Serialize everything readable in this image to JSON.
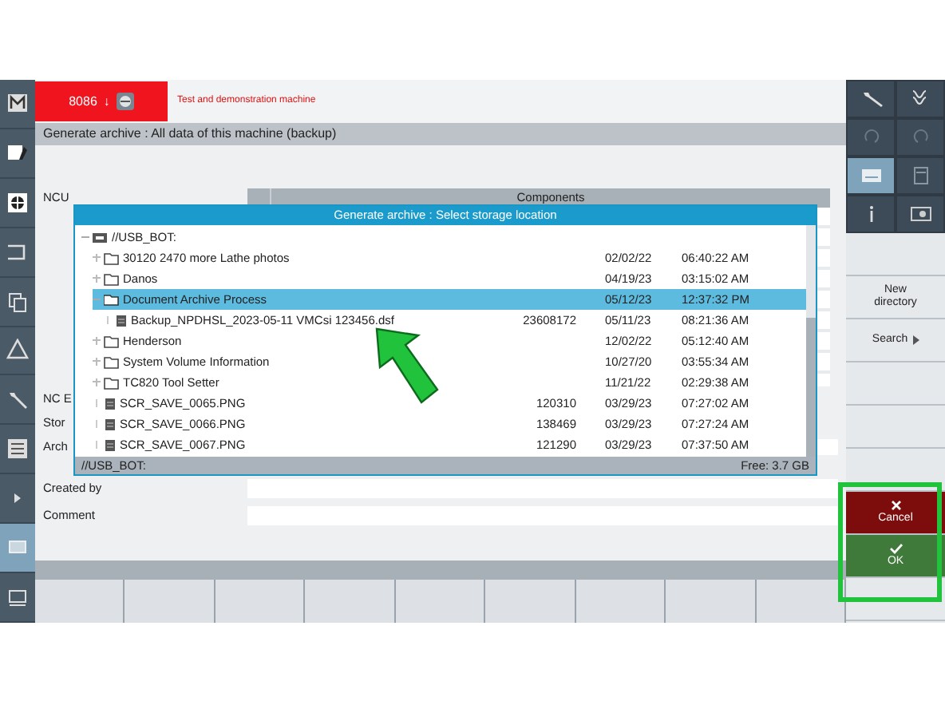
{
  "header": {
    "channel": "8086",
    "channel_mark": "↓",
    "machine": "Test and demonstration machine"
  },
  "title": "Generate archive : All data of this machine (backup)",
  "background": {
    "ncu_label": "NCU",
    "components_header": "Components",
    "rows": [
      {
        "label": "NC E",
        "field": false
      },
      {
        "label": "Stor",
        "field": false
      },
      {
        "label": "Arch",
        "field": true
      }
    ]
  },
  "dialog": {
    "title": "Generate archive : Select storage location",
    "tree": [
      {
        "kind": "drive",
        "name": "//USB_BOT:",
        "expanded": true,
        "selected": false,
        "children": [
          {
            "kind": "folder",
            "name": "30120 2470 more Lathe photos",
            "date": "02/02/22",
            "time": "06:40:22 AM",
            "expanded": false,
            "selected": false
          },
          {
            "kind": "folder",
            "name": "Danos",
            "date": "04/19/23",
            "time": "03:15:02 AM",
            "expanded": false,
            "selected": false
          },
          {
            "kind": "folder",
            "name": "Document Archive Process",
            "date": "05/12/23",
            "time": "12:37:32 PM",
            "expanded": true,
            "selected": true,
            "children": [
              {
                "kind": "file",
                "name": "Backup_NPDHSL_2023-05-11 VMCsi 123456.dsf",
                "size": "23608172",
                "date": "05/11/23",
                "time": "08:21:36 AM",
                "selected": false
              }
            ]
          },
          {
            "kind": "folder",
            "name": "Henderson",
            "date": "12/02/22",
            "time": "05:12:40 AM",
            "expanded": false,
            "selected": false
          },
          {
            "kind": "folder",
            "name": "System Volume Information",
            "date": "10/27/20",
            "time": "03:55:34 AM",
            "expanded": false,
            "selected": false
          },
          {
            "kind": "folder",
            "name": "TC820 Tool Setter",
            "date": "11/21/22",
            "time": "02:29:38 AM",
            "expanded": false,
            "selected": false
          },
          {
            "kind": "file",
            "name": "SCR_SAVE_0065.PNG",
            "size": "120310",
            "date": "03/29/23",
            "time": "07:27:02 AM",
            "selected": false
          },
          {
            "kind": "file",
            "name": "SCR_SAVE_0066.PNG",
            "size": "138469",
            "date": "03/29/23",
            "time": "07:27:24 AM",
            "selected": false
          },
          {
            "kind": "file",
            "name": "SCR_SAVE_0067.PNG",
            "size": "121290",
            "date": "03/29/23",
            "time": "07:37:50 AM",
            "selected": false
          }
        ]
      }
    ],
    "path": "//USB_BOT:",
    "free": "Free: 3.7 GB"
  },
  "form": [
    {
      "label": "Created by"
    },
    {
      "label": "Comment"
    }
  ],
  "softkeys": [
    {
      "kind": "blank"
    },
    {
      "kind": "key",
      "label": "New directory",
      "submenu": false
    },
    {
      "kind": "key",
      "label": "Search",
      "submenu": true
    },
    {
      "kind": "blank"
    },
    {
      "kind": "blank"
    },
    {
      "kind": "blank"
    },
    {
      "kind": "cancel",
      "label": "Cancel"
    },
    {
      "kind": "ok",
      "label": "OK"
    },
    {
      "kind": "blank"
    }
  ]
}
